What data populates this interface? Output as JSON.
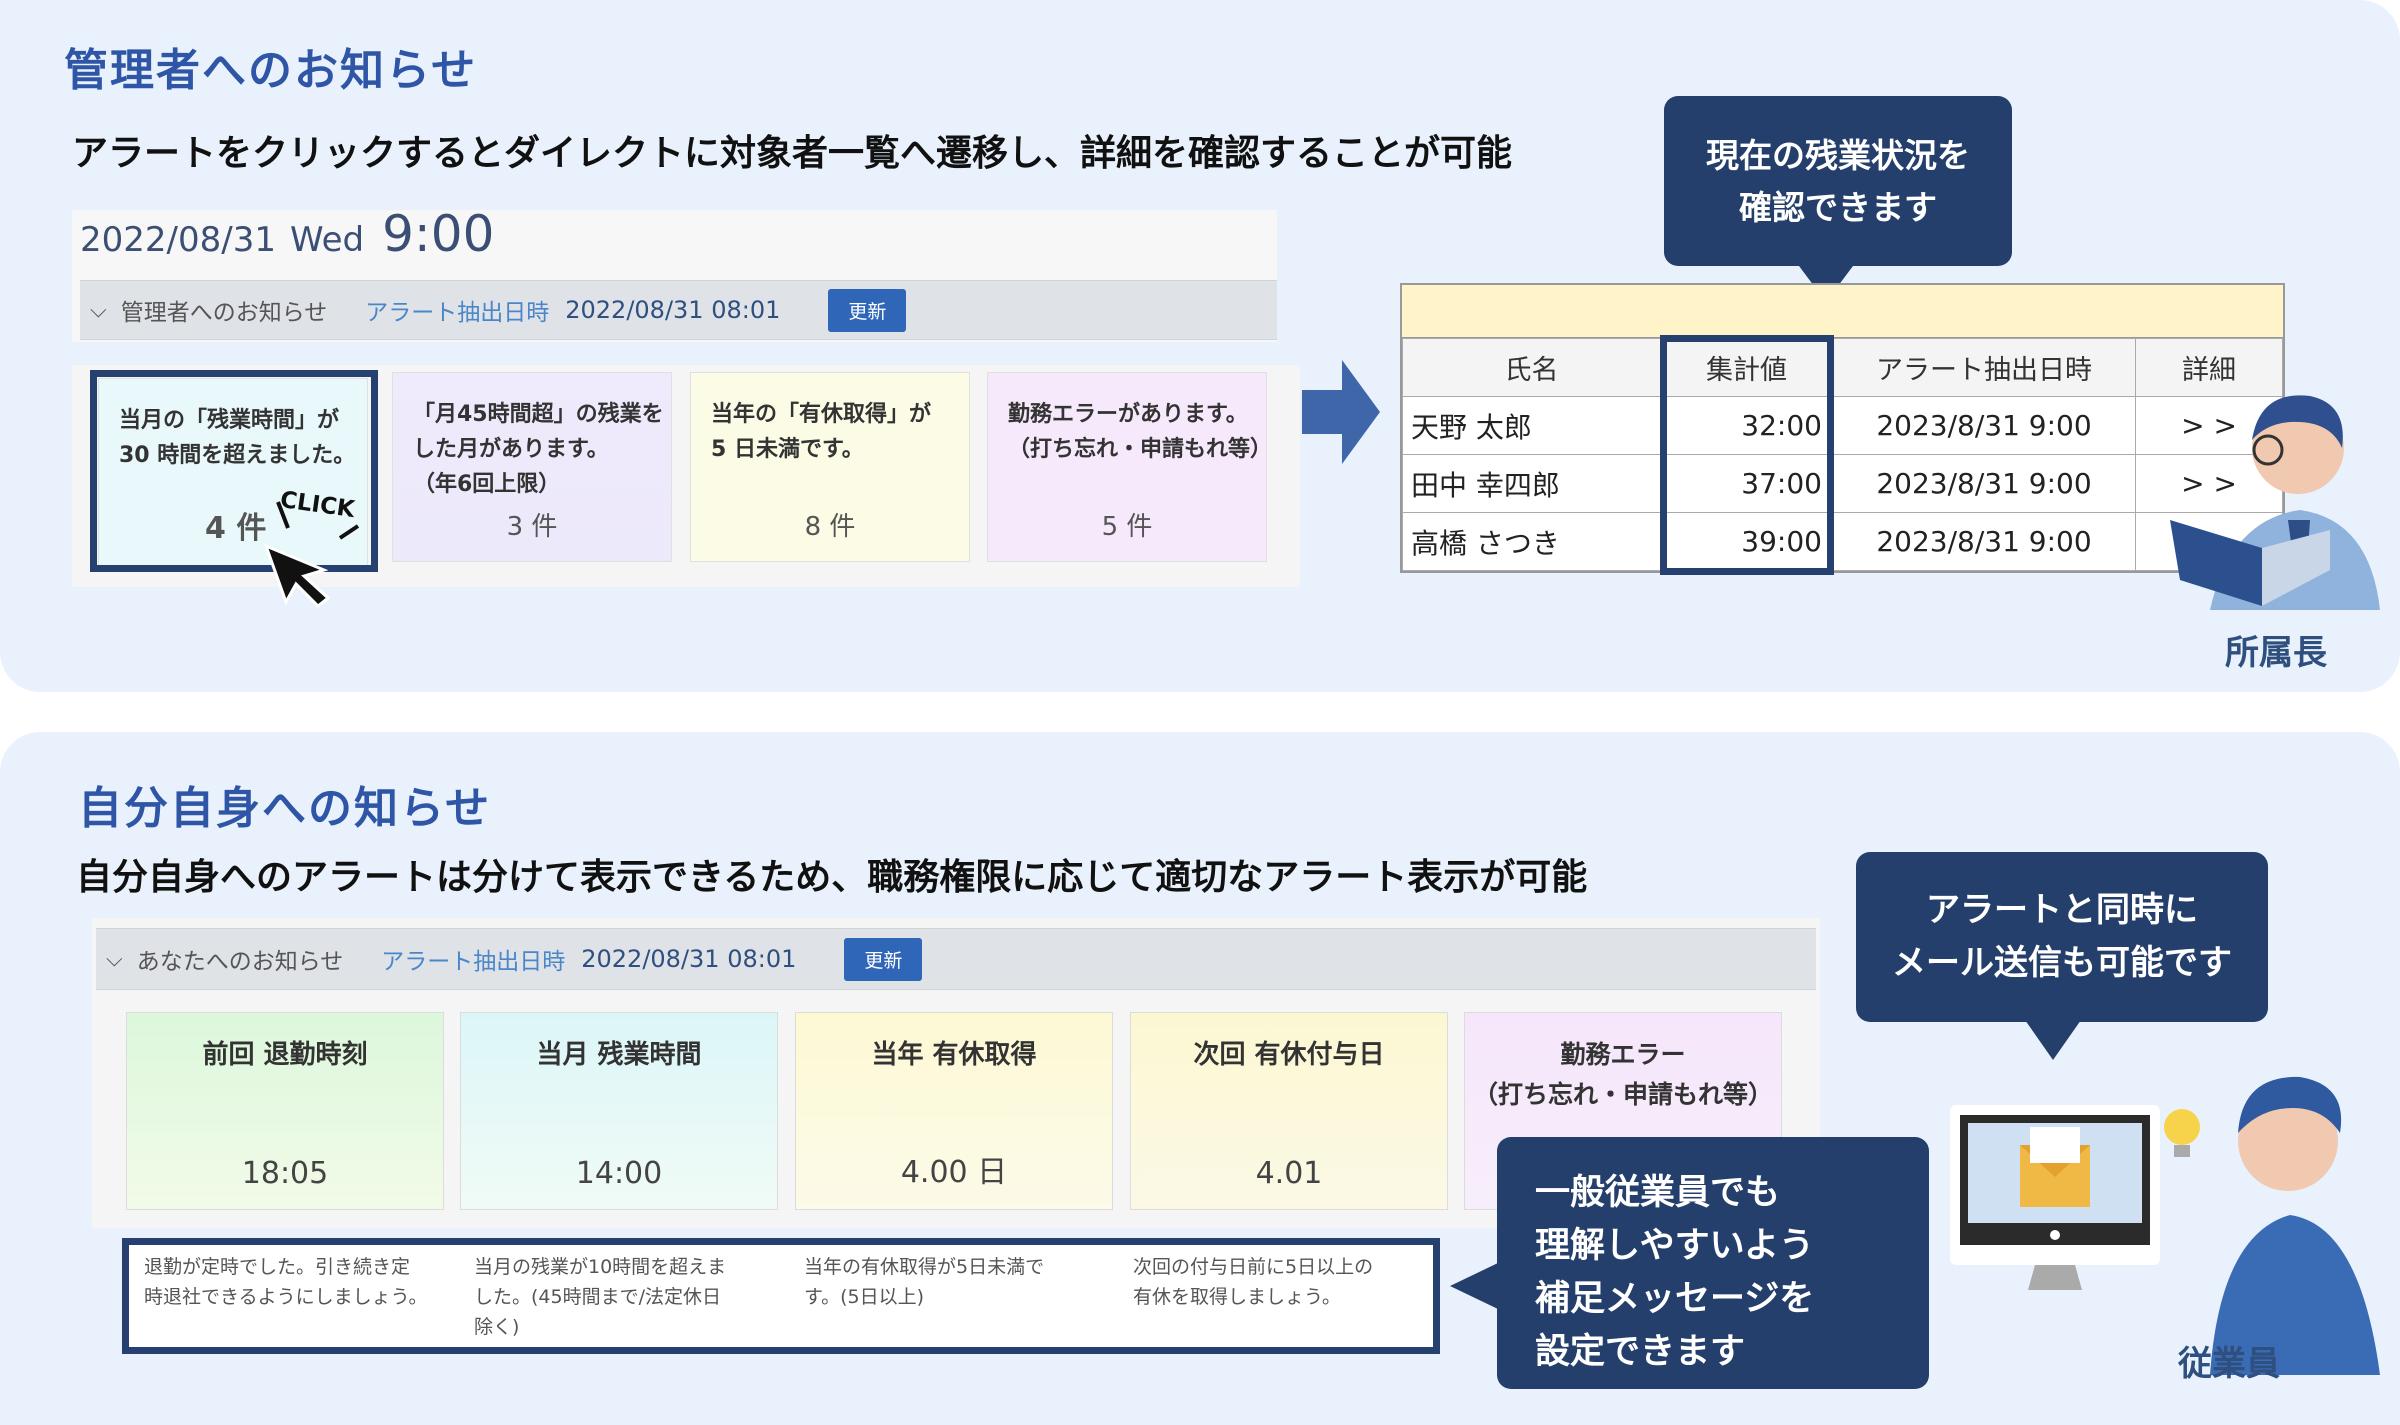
{
  "section_admin": {
    "title": "管理者へのお知らせ",
    "subtitle": "アラートをクリックするとダイレクトに対象者一覧へ遷移し、詳細を確認することが可能",
    "datetime": {
      "date": "2022/08/31",
      "day": "Wed",
      "time": "9:00"
    },
    "bar": {
      "label": "管理者へのお知らせ",
      "alert_label": "アラート抽出日時",
      "alert_date": "2022/08/31 08:01",
      "update_button": "更新"
    },
    "cards": [
      {
        "text": "当月の「残業時間」が\n30 時間を超えました。",
        "count": "4 件"
      },
      {
        "text": "「月45時間超」の残業を\nした月があります。\n（年6回上限）",
        "count": "3 件"
      },
      {
        "text": "当年の「有休取得」が\n5 日未満です。",
        "count": "8 件"
      },
      {
        "text": "勤務エラーがあります。\n（打ち忘れ・申請もれ等）",
        "count": "5 件"
      }
    ],
    "click_label": "CLICK",
    "callout": [
      "現在の残業状況を",
      "確認できます"
    ],
    "table": {
      "headers": [
        "氏名",
        "集計値",
        "アラート抽出日時",
        "詳細"
      ],
      "rows": [
        {
          "name": "天野 太郎",
          "value": "32:00",
          "date": "2023/8/31 9:00",
          "detail": "> >"
        },
        {
          "name": "田中 幸四郎",
          "value": "37:00",
          "date": "2023/8/31 9:00",
          "detail": "> >"
        },
        {
          "name": "高橋 さつき",
          "value": "39:00",
          "date": "2023/8/31 9:00",
          "detail": ""
        }
      ]
    },
    "person_label": "所属長"
  },
  "section_self": {
    "title": "自分自身への知らせ",
    "subtitle": "自分自身へのアラートは分けて表示できるため、職務権限に応じて適切なアラート表示が可能",
    "bar": {
      "label": "あなたへのお知らせ",
      "alert_label": "アラート抽出日時",
      "alert_date": "2022/08/31 08:01",
      "update_button": "更新"
    },
    "cards": [
      {
        "title": "前回 退勤時刻",
        "value": "18:05"
      },
      {
        "title": "当月 残業時間",
        "value": "14:00"
      },
      {
        "title": "当年 有休取得",
        "value": "4.00 日"
      },
      {
        "title": "次回 有休付与日",
        "value": "4.01"
      },
      {
        "title": "勤務エラー\n（打ち忘れ・申請もれ等）",
        "value": ""
      }
    ],
    "messages": [
      "退勤が定時でした。引き続き定\n時退社できるようにしましょう。",
      "当月の残業が10時間を超えま\nした。(45時間まで/法定休日\n除く)",
      "当年の有休取得が5日未満で\nす。(5日以上)",
      "次回の付与日前に5日以上の\n有休を取得しましょう。"
    ],
    "callout_mail": [
      "アラートと同時に",
      "メール送信も可能です"
    ],
    "callout_msg": [
      "一般従業員でも",
      "理解しやすいよう",
      "補足メッセージを",
      "設定できます"
    ],
    "person_label": "従業員"
  },
  "colors": {
    "panel_bg": "#e9f2fc",
    "title_blue": "#2f56a6",
    "callout_navy": "#253f6c",
    "highlight_border": "#26406f",
    "arrow_blue": "#3e66a8"
  }
}
